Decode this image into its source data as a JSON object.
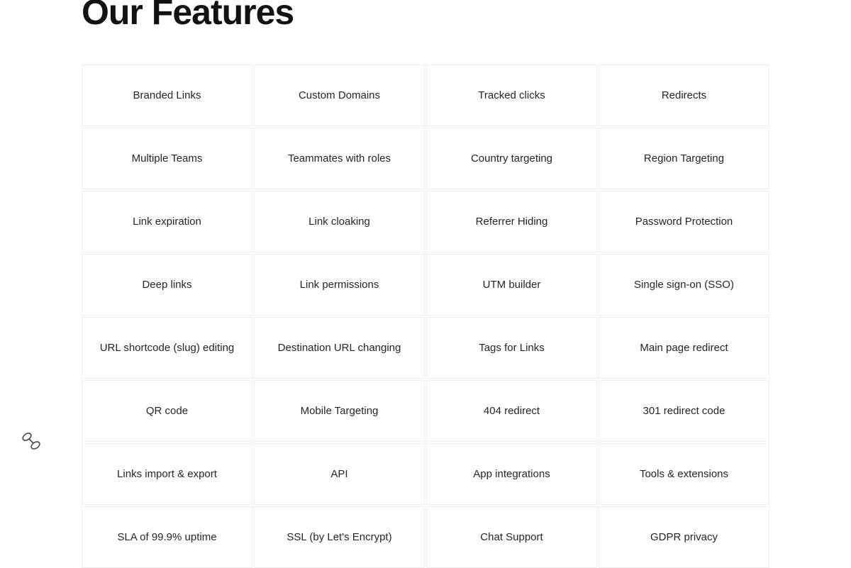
{
  "heading": "Our Features",
  "features": [
    [
      "Branded Links",
      "Custom Domains",
      "Tracked clicks",
      "Redirects"
    ],
    [
      "Multiple Teams",
      "Teammates with roles",
      "Country targeting",
      "Region Targeting"
    ],
    [
      "Link expiration",
      "Link cloaking",
      "Referrer Hiding",
      "Password Protection"
    ],
    [
      "Deep links",
      "Link permissions",
      "UTM builder",
      "Single sign-on (SSO)"
    ],
    [
      "URL shortcode (slug) editing",
      "Destination URL changing",
      "Tags for Links",
      "Main page redirect"
    ],
    [
      "QR code",
      "Mobile Targeting",
      "404 redirect",
      "301 redirect code"
    ],
    [
      "Links import & export",
      "API",
      "App integrations",
      "Tools & extensions"
    ],
    [
      "SLA of 99.9% uptime",
      "SSL (by Let's Encrypt)",
      "Chat Support",
      "GDPR privacy"
    ]
  ]
}
